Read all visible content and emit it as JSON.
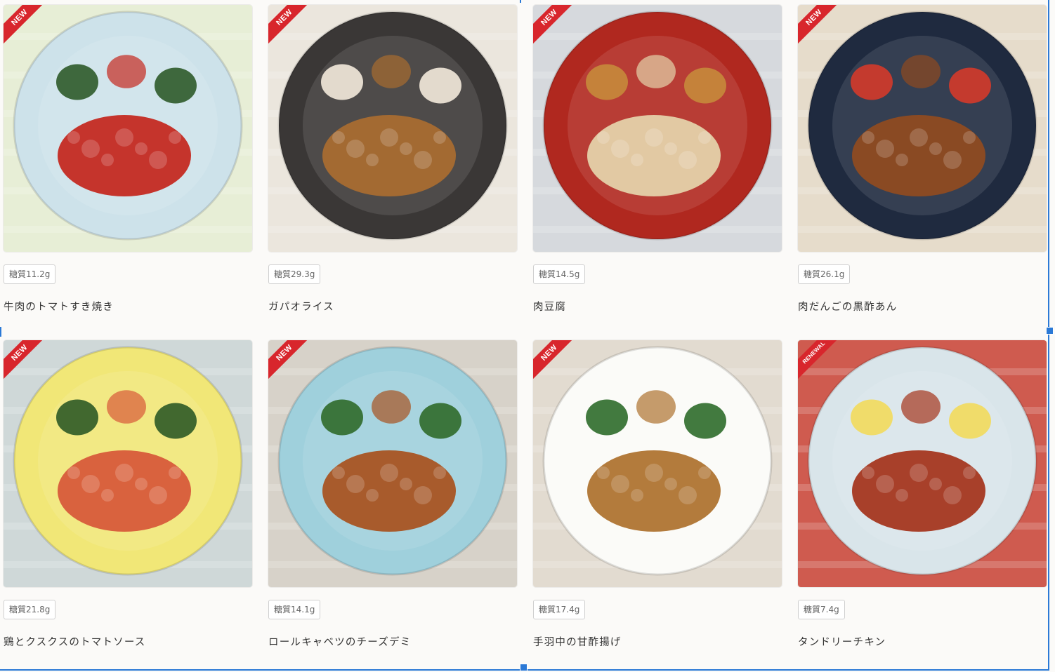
{
  "products": [
    {
      "label": "NEW",
      "carb": "糖質11.2g",
      "name": "牛肉のトマトすき焼き",
      "bg": "#e7eed6",
      "plate": "#cde2ea",
      "food": "#c5342c",
      "side": "#2e5a2a"
    },
    {
      "label": "NEW",
      "carb": "糖質29.3g",
      "name": "ガパオライス",
      "bg": "#ebe6dd",
      "plate": "#3a3736",
      "food": "#a36a32",
      "side": "#f4eadb"
    },
    {
      "label": "NEW",
      "carb": "糖質14.5g",
      "name": "肉豆腐",
      "bg": "#d6d9dd",
      "plate": "#b0281f",
      "food": "#e2c9a3",
      "side": "#c78a3b"
    },
    {
      "label": "NEW",
      "carb": "糖質26.1g",
      "name": "肉だんごの黒酢あん",
      "bg": "#e6dccb",
      "plate": "#1f2a3f",
      "food": "#8a4a23",
      "side": "#d43a2a"
    },
    {
      "label": "NEW",
      "carb": "糖質21.8g",
      "name": "鶏とクスクスのトマトソース",
      "bg": "#cfd8d8",
      "plate": "#f1e777",
      "food": "#d9623e",
      "side": "#2d5a26"
    },
    {
      "label": "NEW",
      "carb": "糖質14.1g",
      "name": "ロールキャベツのチーズデミ",
      "bg": "#d7d2c9",
      "plate": "#9fd0dc",
      "food": "#a85b2c",
      "side": "#2f6a2a"
    },
    {
      "label": "NEW",
      "carb": "糖質17.4g",
      "name": "手羽中の甘酢揚げ",
      "bg": "#e2dbd0",
      "plate": "#fbfbf8",
      "food": "#b37b3c",
      "side": "#2e6b2a"
    },
    {
      "label": "RENEWAL",
      "carb": "糖質7.4g",
      "name": "タンドリーチキン",
      "bg": "#cf5b4f",
      "plate": "#d9e5ea",
      "food": "#a8402a",
      "side": "#f2da5c"
    }
  ],
  "colors": {
    "ribbon": "#d8262c",
    "selection": "#2b79d6",
    "badge_border": "#cfcfcf"
  }
}
